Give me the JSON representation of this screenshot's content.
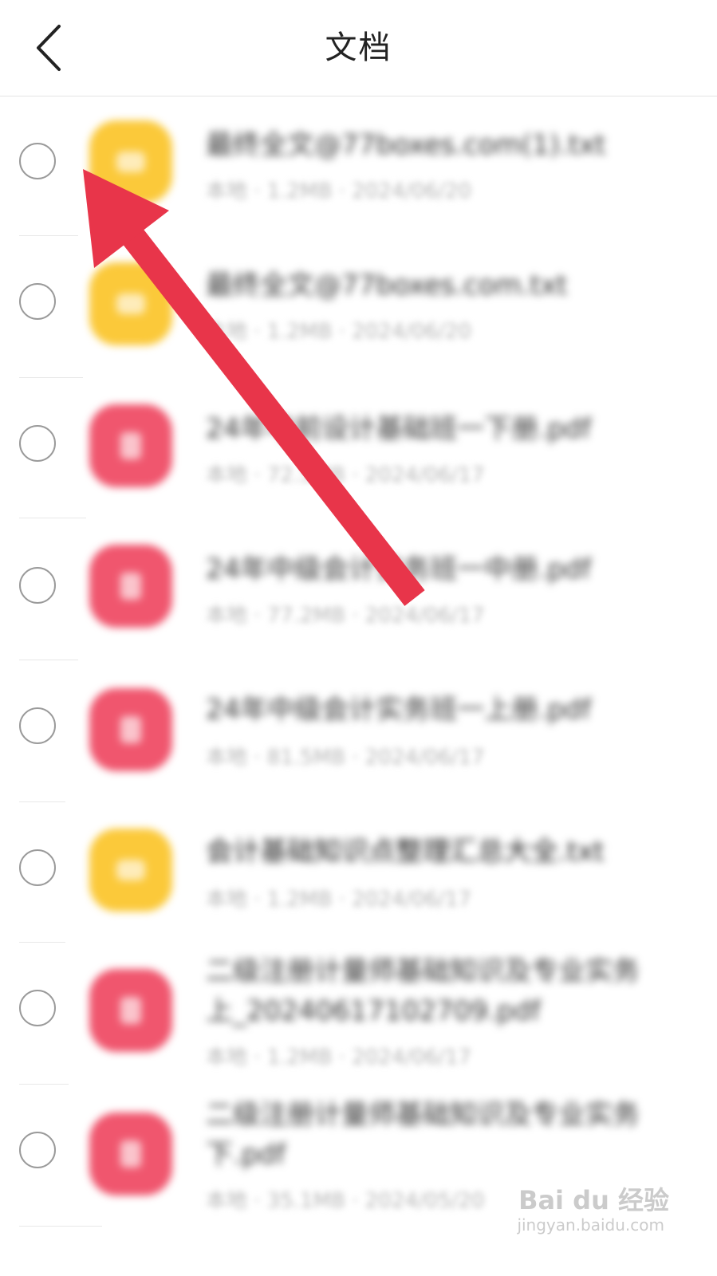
{
  "header": {
    "back_icon": "chevron-left-icon",
    "title": "文档"
  },
  "colors": {
    "doc_icon": "#fbc93a",
    "pdf_icon": "#f0566e",
    "arrow": "#e8354a",
    "radio_border": "#9a9a9a"
  },
  "files": [
    {
      "type": "doc",
      "name": "最终全文@77boxes.com(1).txt",
      "meta": "本地 · 1.2MB · 2024/06/20"
    },
    {
      "type": "doc",
      "name": "最终全文@77boxes.com.txt",
      "meta": "本地 · 1.2MB · 2024/06/20"
    },
    {
      "type": "pdf",
      "name": "24年考前设计基础班一下册.pdf",
      "meta": "本地 · 72.5MB · 2024/06/17"
    },
    {
      "type": "pdf",
      "name": "24年中级会计实务班一中册.pdf",
      "meta": "本地 · 77.2MB · 2024/06/17"
    },
    {
      "type": "pdf",
      "name": "24年中级会计实务班一上册.pdf",
      "meta": "本地 · 81.5MB · 2024/06/17"
    },
    {
      "type": "doc",
      "name": "会计基础知识点整理汇总大全.txt",
      "meta": "本地 · 1.2MB · 2024/06/17"
    },
    {
      "type": "pdf",
      "name": "二级注册计量师基础知识及专业实务上_20240617102709.pdf",
      "meta": "本地 · 1.2MB · 2024/06/17"
    },
    {
      "type": "pdf",
      "name": "二级注册计量师基础知识及专业实务下.pdf",
      "meta": "本地 · 35.1MB · 2024/05/20"
    }
  ],
  "watermark": {
    "logo": "Bai du 经验",
    "sub": "jingyan.baidu.com"
  }
}
